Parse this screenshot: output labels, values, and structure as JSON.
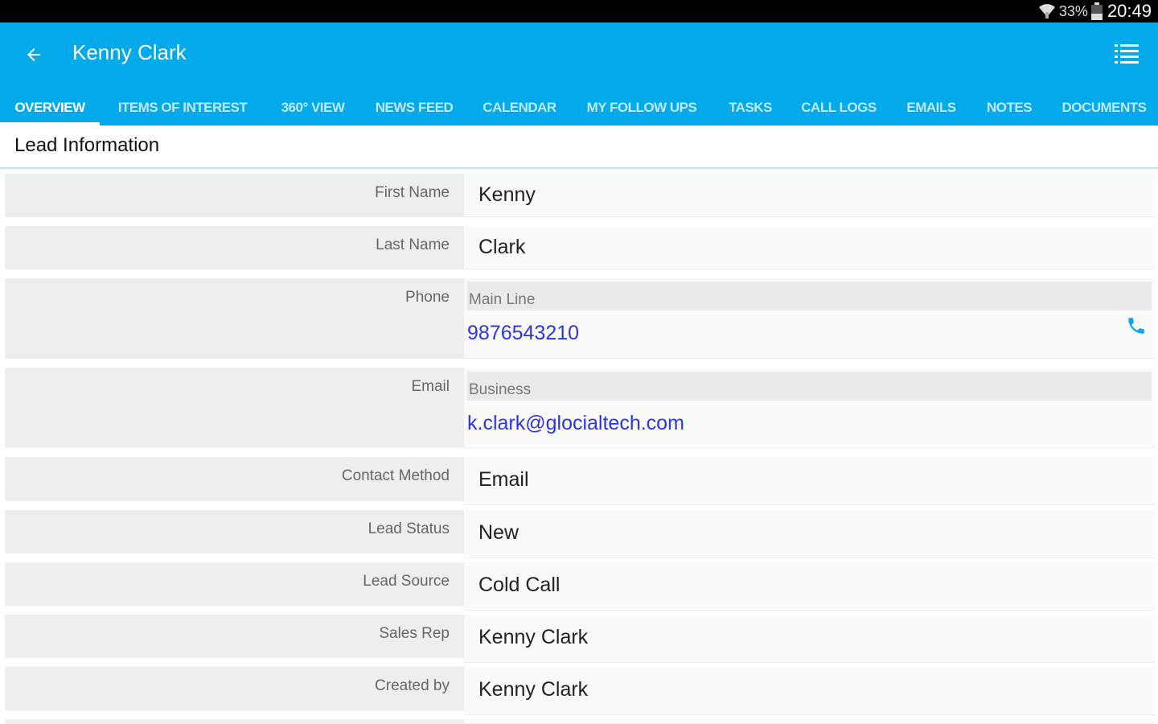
{
  "status": {
    "battery_pct": "33%",
    "clock": "20:49"
  },
  "header": {
    "title": "Kenny Clark"
  },
  "tabs": [
    {
      "label": "OVERVIEW",
      "active": true
    },
    {
      "label": "ITEMS OF INTEREST"
    },
    {
      "label": "360° VIEW"
    },
    {
      "label": "NEWS FEED"
    },
    {
      "label": "CALENDAR"
    },
    {
      "label": "MY FOLLOW UPS"
    },
    {
      "label": "TASKS"
    },
    {
      "label": "CALL LOGS"
    },
    {
      "label": "EMAILS"
    },
    {
      "label": "NOTES"
    },
    {
      "label": "DOCUMENTS"
    }
  ],
  "section": {
    "title": "Lead Information"
  },
  "fields": {
    "first_name": {
      "label": "First Name",
      "value": "Kenny"
    },
    "last_name": {
      "label": "Last Name",
      "value": "Clark"
    },
    "phone": {
      "label": "Phone",
      "type": "Main Line",
      "value": "9876543210"
    },
    "email": {
      "label": "Email",
      "type": "Business",
      "value": "k.clark@glocialtech.com"
    },
    "contact_method": {
      "label": "Contact Method",
      "value": "Email"
    },
    "lead_status": {
      "label": "Lead Status",
      "value": "New"
    },
    "lead_source": {
      "label": "Lead Source",
      "value": "Cold Call"
    },
    "sales_rep": {
      "label": "Sales Rep",
      "value": "Kenny Clark"
    },
    "created_by": {
      "label": "Created by",
      "value": "Kenny Clark"
    }
  },
  "colors": {
    "accent": "#03a9e8",
    "link": "#2b35e6"
  }
}
